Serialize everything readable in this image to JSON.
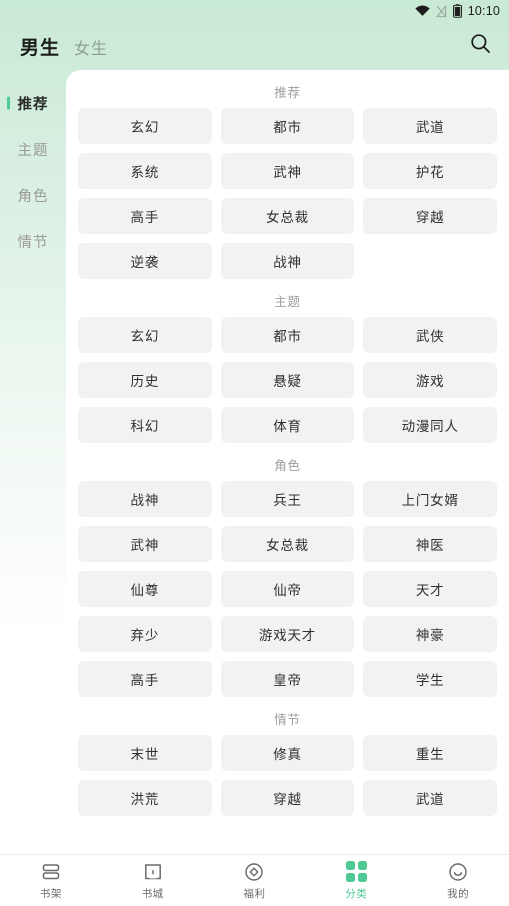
{
  "statusbar": {
    "time": "10:10",
    "icons": [
      "wifi-icon",
      "signal-off-icon",
      "battery-icon"
    ]
  },
  "header": {
    "tab_male": "男生",
    "tab_female": "女生",
    "active_tab": "男生",
    "search_icon": "search-icon"
  },
  "colors": {
    "accent": "#4ecb95",
    "header_gradient_top": "#c8e9d4",
    "chip_bg": "#f2f2f2",
    "chip_text": "#303030",
    "section_title": "#9d9d9d"
  },
  "sidebar": {
    "items": [
      {
        "label": "推荐",
        "active": true
      },
      {
        "label": "主题",
        "active": false
      },
      {
        "label": "角色",
        "active": false
      },
      {
        "label": "情节",
        "active": false
      }
    ]
  },
  "main": {
    "sections": [
      {
        "title": "推荐",
        "chips": [
          "玄幻",
          "都市",
          "武道",
          "系统",
          "武神",
          "护花",
          "高手",
          "女总裁",
          "穿越",
          "逆袭",
          "战神"
        ]
      },
      {
        "title": "主题",
        "chips": [
          "玄幻",
          "都市",
          "武侠",
          "历史",
          "悬疑",
          "游戏",
          "科幻",
          "体育",
          "动漫同人"
        ]
      },
      {
        "title": "角色",
        "chips": [
          "战神",
          "兵王",
          "上门女婿",
          "武神",
          "女总裁",
          "神医",
          "仙尊",
          "仙帝",
          "天才",
          "弃少",
          "游戏天才",
          "神豪",
          "高手",
          "皇帝",
          "学生"
        ]
      },
      {
        "title": "情节",
        "chips": [
          "末世",
          "修真",
          "重生",
          "洪荒",
          "穿越",
          "武道"
        ]
      }
    ]
  },
  "bottomnav": {
    "items": [
      {
        "label": "书架",
        "icon": "bookshelf-icon",
        "active": false
      },
      {
        "label": "书城",
        "icon": "open-book-icon",
        "active": false
      },
      {
        "label": "福利",
        "icon": "gift-circle-icon",
        "active": false
      },
      {
        "label": "分类",
        "icon": "grid-category-icon",
        "active": true
      },
      {
        "label": "我的",
        "icon": "profile-smiley-icon",
        "active": false
      }
    ]
  }
}
